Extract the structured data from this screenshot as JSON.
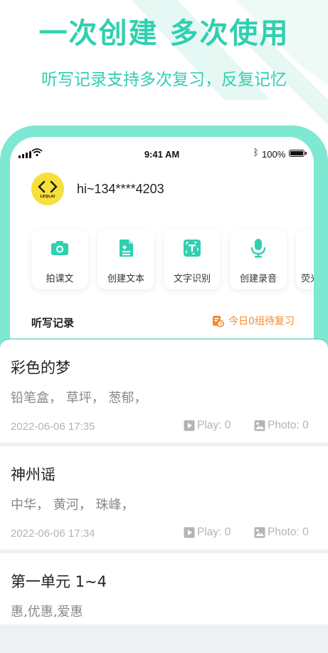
{
  "headline": "一次创建  多次使用",
  "subheadline": "听写记录支持多次复习，反复记忆",
  "colors": {
    "brand": "#2fd0b0",
    "orange": "#f58a2a",
    "avatar_bg": "#f7e03a"
  },
  "status_bar": {
    "time": "9:41 AM",
    "battery": "100%"
  },
  "profile": {
    "avatar_text": "LEQLAI",
    "greeting": "hi~134****4203"
  },
  "actions": [
    {
      "label": "拍课文",
      "icon": "camera-icon"
    },
    {
      "label": "创建文本",
      "icon": "document-icon"
    },
    {
      "label": "文字识别",
      "icon": "text-scan-icon"
    },
    {
      "label": "创建录音",
      "icon": "microphone-icon"
    },
    {
      "label": "荧光",
      "icon": "highlighter-icon"
    }
  ],
  "records": {
    "title": "听写记录",
    "review_status": "今日0组待复习"
  },
  "cards": [
    {
      "title": "彩色的梦",
      "words": "铅笔盒，  草坪，  葱郁，",
      "date": "2022-06-06 17:35",
      "play": "Play: 0",
      "photo": "Photo: 0"
    },
    {
      "title": "神州谣",
      "words": "中华，  黄河，  珠峰，",
      "date": "2022-06-06 17:34",
      "play": "Play: 0",
      "photo": "Photo: 0"
    },
    {
      "title": "第一单元 1~4",
      "words": "惠,优惠,爱惠"
    }
  ]
}
